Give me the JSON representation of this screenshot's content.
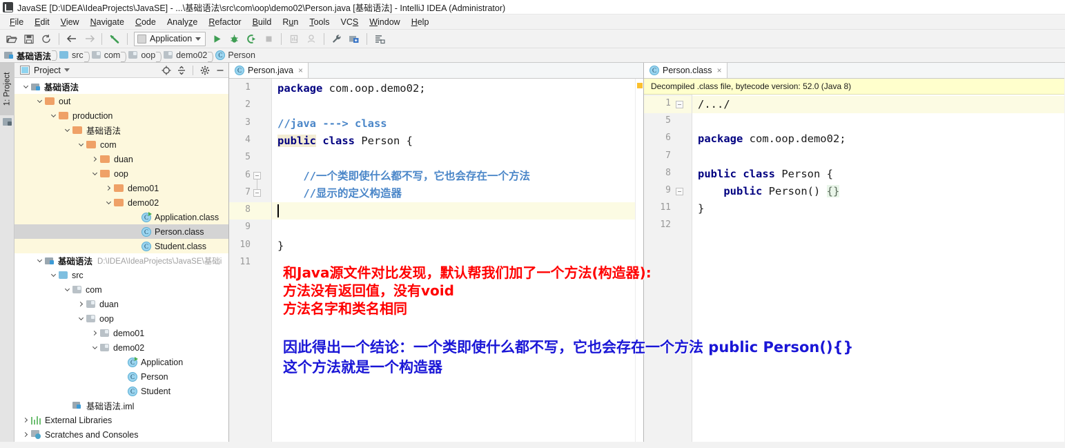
{
  "window": {
    "title": "JavaSE [D:\\IDEA\\IdeaProjects\\JavaSE] - ...\\基础语法\\src\\com\\oop\\demo02\\Person.java [基础语法] - IntelliJ IDEA (Administrator)",
    "app_icon": "intellij-idea-icon"
  },
  "menubar": {
    "items": [
      {
        "label": "File",
        "mnemonic": "F"
      },
      {
        "label": "Edit",
        "mnemonic": "E"
      },
      {
        "label": "View",
        "mnemonic": "V"
      },
      {
        "label": "Navigate",
        "mnemonic": "N"
      },
      {
        "label": "Code",
        "mnemonic": "C"
      },
      {
        "label": "Analyze",
        "mnemonic": "z"
      },
      {
        "label": "Refactor",
        "mnemonic": "R"
      },
      {
        "label": "Build",
        "mnemonic": "B"
      },
      {
        "label": "Run",
        "mnemonic": "u"
      },
      {
        "label": "Tools",
        "mnemonic": "T"
      },
      {
        "label": "VCS",
        "mnemonic": "S"
      },
      {
        "label": "Window",
        "mnemonic": "W"
      },
      {
        "label": "Help",
        "mnemonic": "H"
      }
    ]
  },
  "toolbar": {
    "buttons": [
      "open-folder-icon",
      "save-all-icon",
      "sync-refresh-icon",
      "back-arrow-icon",
      "forward-arrow-icon",
      "undo-arrow-icon"
    ],
    "run_config": {
      "label": "Application",
      "icon": "run-configuration-icon",
      "dropdown": "chevron-down-icon"
    },
    "right_buttons": [
      "run-icon",
      "debug-icon",
      "run-with-coverage-icon",
      "stop-icon",
      "profiler-icon",
      "attach-debugger-icon",
      "settings-wrench-icon",
      "project-structure-icon",
      "search-everywhere-icon"
    ]
  },
  "breadcrumb": {
    "items": [
      {
        "label": "基础语法",
        "icon": "module-icon",
        "current": true
      },
      {
        "label": "src",
        "icon": "source-folder-icon"
      },
      {
        "label": "com",
        "icon": "package-icon"
      },
      {
        "label": "oop",
        "icon": "package-icon"
      },
      {
        "label": "demo02",
        "icon": "package-icon"
      },
      {
        "label": "Person",
        "icon": "class-icon"
      }
    ]
  },
  "toolstrip": {
    "label": "1: Project",
    "icon": "project-structure-icon"
  },
  "project_panel": {
    "title": "Project",
    "dropdown": "chevron-down-icon",
    "actions": [
      "target-locate-icon",
      "collapse-all-icon",
      "settings-gear-icon",
      "hide-minimize-icon"
    ],
    "tree": [
      {
        "label": "基础语法",
        "icon": "module-icon",
        "indent": 0,
        "arrow": "down",
        "bold": true,
        "highlight": "none"
      },
      {
        "label": "out",
        "icon": "folder-orange-icon",
        "indent": 1,
        "arrow": "down",
        "highlight": "yellow"
      },
      {
        "label": "production",
        "icon": "folder-orange-icon",
        "indent": 2,
        "arrow": "down",
        "highlight": "yellow"
      },
      {
        "label": "基础语法",
        "icon": "folder-orange-icon",
        "indent": 3,
        "arrow": "down",
        "highlight": "yellow"
      },
      {
        "label": "com",
        "icon": "folder-orange-icon",
        "indent": 4,
        "arrow": "down",
        "highlight": "yellow"
      },
      {
        "label": "duan",
        "icon": "folder-orange-icon",
        "indent": 5,
        "arrow": "right",
        "highlight": "yellow"
      },
      {
        "label": "oop",
        "icon": "folder-orange-icon",
        "indent": 5,
        "arrow": "down",
        "highlight": "yellow"
      },
      {
        "label": "demo01",
        "icon": "folder-orange-icon",
        "indent": 6,
        "arrow": "right",
        "highlight": "yellow"
      },
      {
        "label": "demo02",
        "icon": "folder-orange-icon",
        "indent": 6,
        "arrow": "down",
        "highlight": "yellow"
      },
      {
        "label": "Application.class",
        "icon": "class-runnable-icon",
        "indent": 8,
        "arrow": "none",
        "highlight": "yellow"
      },
      {
        "label": "Person.class",
        "icon": "class-icon",
        "indent": 8,
        "arrow": "none",
        "highlight": "selected"
      },
      {
        "label": "Student.class",
        "icon": "class-icon",
        "indent": 8,
        "arrow": "none",
        "highlight": "yellow"
      },
      {
        "label": "基础语法",
        "icon": "module-icon",
        "indent": 1,
        "arrow": "down",
        "bold": true,
        "path": "D:\\IDEA\\IdeaProjects\\JavaSE\\基础i",
        "highlight": "none"
      },
      {
        "label": "src",
        "icon": "source-folder-icon",
        "indent": 2,
        "arrow": "down",
        "highlight": "none"
      },
      {
        "label": "com",
        "icon": "package-icon",
        "indent": 3,
        "arrow": "down",
        "highlight": "none"
      },
      {
        "label": "duan",
        "icon": "package-icon",
        "indent": 4,
        "arrow": "right",
        "highlight": "none"
      },
      {
        "label": "oop",
        "icon": "package-icon",
        "indent": 4,
        "arrow": "down",
        "highlight": "none"
      },
      {
        "label": "demo01",
        "icon": "package-icon",
        "indent": 5,
        "arrow": "right",
        "highlight": "none"
      },
      {
        "label": "demo02",
        "icon": "package-icon",
        "indent": 5,
        "arrow": "down",
        "highlight": "none"
      },
      {
        "label": "Application",
        "icon": "class-runnable-icon",
        "indent": 7,
        "arrow": "none",
        "highlight": "none"
      },
      {
        "label": "Person",
        "icon": "class-icon",
        "indent": 7,
        "arrow": "none",
        "highlight": "none"
      },
      {
        "label": "Student",
        "icon": "class-icon",
        "indent": 7,
        "arrow": "none",
        "highlight": "none"
      },
      {
        "label": "基础语法.iml",
        "icon": "iml-file-icon",
        "indent": 3,
        "arrow": "none",
        "highlight": "none"
      },
      {
        "label": "External Libraries",
        "icon": "libraries-icon",
        "indent": 0,
        "arrow": "right",
        "highlight": "none"
      },
      {
        "label": "Scratches and Consoles",
        "icon": "scratches-icon",
        "indent": 0,
        "arrow": "right",
        "highlight": "none"
      }
    ]
  },
  "editor_left": {
    "tab": {
      "label": "Person.java",
      "icon": "java-class-icon",
      "close": "×"
    },
    "line_numbers": [
      "1",
      "2",
      "3",
      "4",
      "5",
      "6",
      "7",
      "8",
      "9",
      "10",
      "11"
    ],
    "highlighted_line": "8",
    "code": [
      {
        "n": 1,
        "segments": [
          {
            "t": "package",
            "c": "kw"
          },
          {
            "t": " com.oop.demo02;",
            "c": "plain"
          }
        ]
      },
      {
        "n": 2,
        "segments": []
      },
      {
        "n": 3,
        "segments": [
          {
            "t": "//java ---> class",
            "c": "cm"
          }
        ]
      },
      {
        "n": 4,
        "segments": [
          {
            "t": "public",
            "c": "kw hl-word"
          },
          {
            "t": " ",
            "c": "plain"
          },
          {
            "t": "class",
            "c": "kw"
          },
          {
            "t": " Person {",
            "c": "plain"
          }
        ]
      },
      {
        "n": 5,
        "segments": []
      },
      {
        "n": 6,
        "segments": [
          {
            "t": "    //一个类即使什么都不写，它也会存在一个方法",
            "c": "cm"
          }
        ]
      },
      {
        "n": 7,
        "segments": [
          {
            "t": "    //显示的定义构造器",
            "c": "cm"
          }
        ]
      },
      {
        "n": 8,
        "segments": []
      },
      {
        "n": 9,
        "segments": []
      },
      {
        "n": 10,
        "segments": [
          {
            "t": "}",
            "c": "plain"
          }
        ]
      },
      {
        "n": 11,
        "segments": []
      }
    ]
  },
  "editor_right": {
    "tab": {
      "label": "Person.class",
      "icon": "java-class-icon",
      "close": "×"
    },
    "notice": "Decompiled .class file, bytecode version: 52.0 (Java 8)",
    "line_numbers": [
      "1",
      "5",
      "6",
      "7",
      "8",
      "9",
      "11",
      "12"
    ],
    "code": [
      {
        "n": "1",
        "segments": [
          {
            "t": "/.../",
            "c": "cm-fold"
          }
        ]
      },
      {
        "n": "5",
        "segments": []
      },
      {
        "n": "6",
        "segments": [
          {
            "t": "package",
            "c": "kw"
          },
          {
            "t": " com.oop.demo02;",
            "c": "plain"
          }
        ]
      },
      {
        "n": "7",
        "segments": []
      },
      {
        "n": "8",
        "segments": [
          {
            "t": "public",
            "c": "kw"
          },
          {
            "t": " ",
            "c": "plain"
          },
          {
            "t": "class",
            "c": "kw"
          },
          {
            "t": " Person {",
            "c": "plain"
          }
        ]
      },
      {
        "n": "9",
        "segments": [
          {
            "t": "    ",
            "c": "plain"
          },
          {
            "t": "public",
            "c": "kw"
          },
          {
            "t": " Person() ",
            "c": "plain"
          },
          {
            "t": "{}",
            "c": "fold-brace"
          }
        ]
      },
      {
        "n": "11",
        "segments": [
          {
            "t": "}",
            "c": "plain"
          }
        ]
      },
      {
        "n": "12",
        "segments": []
      }
    ]
  },
  "annotations": {
    "red_lines": [
      "和Java源文件对比发现，默认帮我们加了一个方法(构造器):",
      "方法没有返回值，没有void",
      "方法名字和类名相同"
    ],
    "blue_lines": [
      "因此得出一个结论：一个类即使什么都不写，它也会存在一个方法 public Person(){}",
      "这个方法就是一个构造器"
    ],
    "colors": {
      "red": "#ff0000",
      "blue": "#1a16d6"
    }
  }
}
